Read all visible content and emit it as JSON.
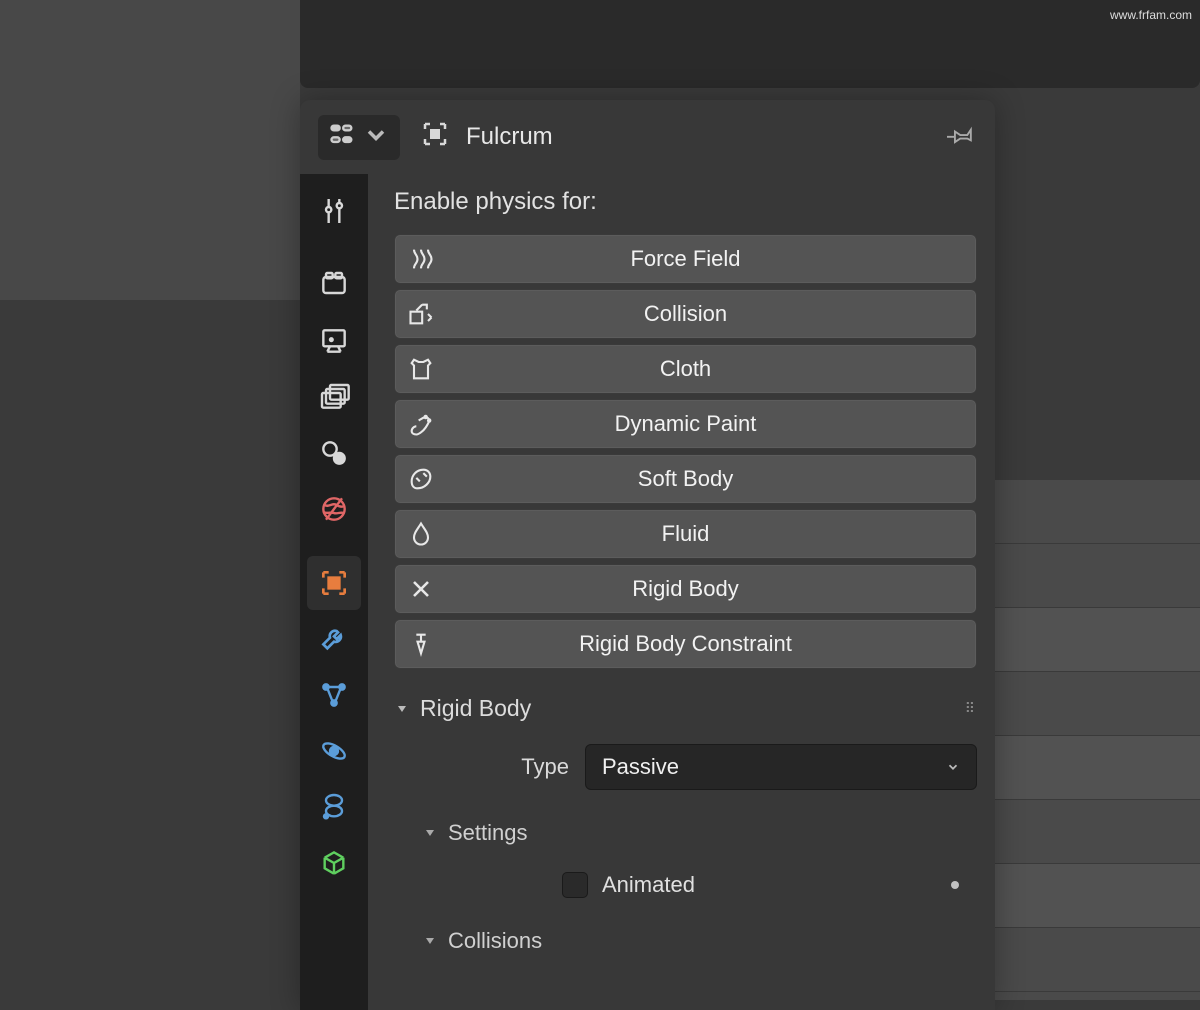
{
  "header": {
    "object_name": "Fulcrum"
  },
  "section_title": "Enable physics for:",
  "physics_buttons": [
    {
      "label": "Force Field",
      "icon": "force-field-icon",
      "active": false
    },
    {
      "label": "Collision",
      "icon": "collision-icon",
      "active": false
    },
    {
      "label": "Cloth",
      "icon": "cloth-icon",
      "active": false
    },
    {
      "label": "Dynamic Paint",
      "icon": "dynamic-paint-icon",
      "active": false
    },
    {
      "label": "Soft Body",
      "icon": "soft-body-icon",
      "active": false
    },
    {
      "label": "Fluid",
      "icon": "fluid-icon",
      "active": false
    },
    {
      "label": "Rigid Body",
      "icon": "rigid-body-icon",
      "active": true
    },
    {
      "label": "Rigid Body Constraint",
      "icon": "rigid-body-constraint-icon",
      "active": false
    }
  ],
  "tabs": [
    {
      "name": "tool-tab",
      "icon": "tool-icon"
    },
    {
      "name": "render-tab",
      "icon": "render-icon"
    },
    {
      "name": "output-tab",
      "icon": "output-icon"
    },
    {
      "name": "viewlayer-tab",
      "icon": "viewlayer-icon"
    },
    {
      "name": "scene-tab",
      "icon": "scene-icon"
    },
    {
      "name": "world-tab",
      "icon": "world-icon"
    },
    {
      "name": "object-tab",
      "icon": "object-icon"
    },
    {
      "name": "modifier-tab",
      "icon": "modifier-icon"
    },
    {
      "name": "particles-tab",
      "icon": "particles-icon"
    },
    {
      "name": "physics-tab",
      "icon": "physics-icon"
    },
    {
      "name": "constraints-tab",
      "icon": "constraints-icon"
    },
    {
      "name": "data-tab",
      "icon": "data-icon"
    }
  ],
  "rigid_body": {
    "title": "Rigid Body",
    "type_label": "Type",
    "type_value": "Passive",
    "settings": {
      "title": "Settings",
      "animated_label": "Animated",
      "animated_checked": false
    },
    "collisions": {
      "title": "Collisions"
    }
  },
  "watermark": "www.frfam.com"
}
